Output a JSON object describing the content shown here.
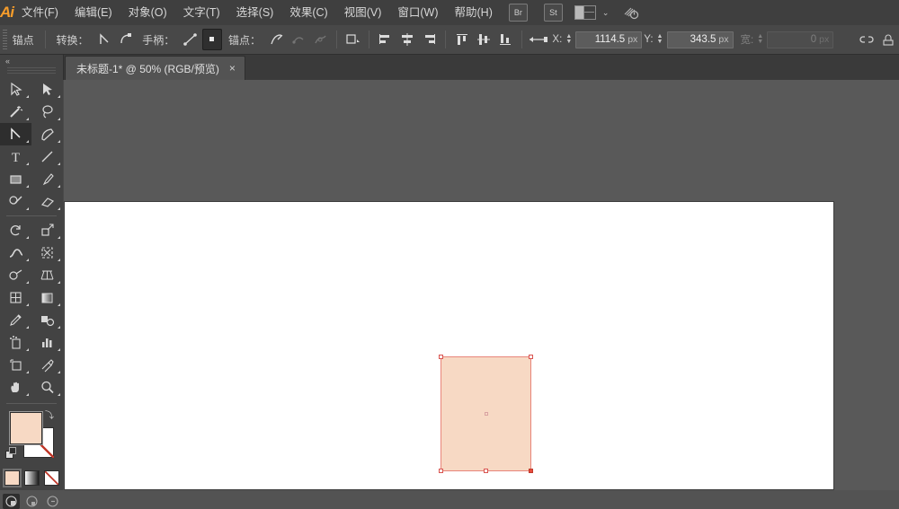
{
  "app": {
    "name": "Adobe Illustrator",
    "logo_text": "Ai"
  },
  "menubar": {
    "items": [
      {
        "label": "文件(F)",
        "name": "menu-file"
      },
      {
        "label": "编辑(E)",
        "name": "menu-edit"
      },
      {
        "label": "对象(O)",
        "name": "menu-object"
      },
      {
        "label": "文字(T)",
        "name": "menu-type"
      },
      {
        "label": "选择(S)",
        "name": "menu-select"
      },
      {
        "label": "效果(C)",
        "name": "menu-effect"
      },
      {
        "label": "视图(V)",
        "name": "menu-view"
      },
      {
        "label": "窗口(W)",
        "name": "menu-window"
      },
      {
        "label": "帮助(H)",
        "name": "menu-help"
      }
    ],
    "bridge_label": "Br",
    "stock_label": "St",
    "workspace_icon": "workspace-switcher-icon",
    "chevron": "⌄",
    "search_icon": "search-help-icon"
  },
  "controlbar": {
    "title": "锚点",
    "convert_label": "转换：",
    "handles_label": "手柄：",
    "anchors_label": "锚点：",
    "x_label": "X:",
    "x_value": "1114.5",
    "x_unit": "px",
    "y_label": "Y:",
    "y_value": "343.5",
    "y_unit": "px",
    "w_label": "宽:",
    "w_value": "0",
    "w_unit": "px",
    "icons": [
      "convert-to-corner-icon",
      "convert-to-smooth-icon",
      "show-handles-icon",
      "hide-handles-icon",
      "remove-anchor-icon",
      "connect-anchor-icon",
      "cut-path-icon",
      "isolate-object-icon",
      "transform-icon",
      "align-left-icon",
      "align-center-h-icon",
      "align-right-icon",
      "align-top-icon",
      "align-middle-v-icon",
      "align-bottom-icon",
      "distribute-icon",
      "link-broken-icon",
      "more-options-icon"
    ]
  },
  "tabbar": {
    "document_title": "未标题-1* @ 50% (RGB/预览)",
    "close_glyph": "×"
  },
  "toolbar": {
    "collapse_glyph": "«",
    "tools": [
      {
        "name": "selection-tool",
        "row": 0,
        "col": 0
      },
      {
        "name": "direct-selection-tool",
        "row": 0,
        "col": 1
      },
      {
        "name": "magic-wand-tool",
        "row": 1,
        "col": 0
      },
      {
        "name": "lasso-tool",
        "row": 1,
        "col": 1
      },
      {
        "name": "anchor-point-tool",
        "row": 2,
        "col": 0,
        "selected": true
      },
      {
        "name": "curvature-tool",
        "row": 2,
        "col": 1
      },
      {
        "name": "type-tool",
        "row": 3,
        "col": 0
      },
      {
        "name": "line-segment-tool",
        "row": 3,
        "col": 1
      },
      {
        "name": "rectangle-tool",
        "row": 4,
        "col": 0
      },
      {
        "name": "paintbrush-tool",
        "row": 4,
        "col": 1
      },
      {
        "name": "pencil-tool",
        "row": 5,
        "col": 0
      },
      {
        "name": "eraser-tool",
        "row": 5,
        "col": 1
      },
      {
        "name": "rotate-tool",
        "row": 6,
        "col": 0
      },
      {
        "name": "scale-tool",
        "row": 6,
        "col": 1
      },
      {
        "name": "width-tool",
        "row": 7,
        "col": 0
      },
      {
        "name": "free-transform-tool",
        "row": 7,
        "col": 1
      },
      {
        "name": "shape-builder-tool",
        "row": 8,
        "col": 0
      },
      {
        "name": "perspective-grid-tool",
        "row": 8,
        "col": 1
      },
      {
        "name": "mesh-tool",
        "row": 9,
        "col": 0
      },
      {
        "name": "gradient-tool",
        "row": 9,
        "col": 1
      },
      {
        "name": "eyedropper-tool",
        "row": 10,
        "col": 0
      },
      {
        "name": "blend-tool",
        "row": 10,
        "col": 1
      },
      {
        "name": "symbol-sprayer-tool",
        "row": 11,
        "col": 0
      },
      {
        "name": "column-graph-tool",
        "row": 11,
        "col": 1
      },
      {
        "name": "artboard-tool",
        "row": 12,
        "col": 0
      },
      {
        "name": "slice-tool",
        "row": 12,
        "col": 1
      },
      {
        "name": "hand-tool",
        "row": 13,
        "col": 0
      },
      {
        "name": "zoom-tool",
        "row": 13,
        "col": 1
      }
    ],
    "fill_color": "#f7d9c4",
    "stroke_color": "none",
    "swap_icon": "swap-fill-stroke-icon",
    "default_icon": "default-fill-stroke-icon",
    "color_modes": [
      "color-mode-button",
      "gradient-mode-button",
      "none-mode-button"
    ],
    "screen_modes": [
      "screen-mode-normal",
      "screen-mode-full-menu",
      "screen-mode-full"
    ]
  },
  "canvas": {
    "artboard_background": "#ffffff",
    "canvas_background": "#595959",
    "shape": {
      "name": "rectangle-shape",
      "fill": "#f7d9c4",
      "path_color": "#e8857a",
      "anchors": [
        {
          "position": "top-left",
          "selected": false
        },
        {
          "position": "top-right",
          "selected": false
        },
        {
          "position": "bottom-left",
          "selected": false
        },
        {
          "position": "bottom-center",
          "selected": false
        },
        {
          "position": "bottom-right",
          "selected": true
        }
      ],
      "center_point": "center-anchor-indicator"
    }
  }
}
